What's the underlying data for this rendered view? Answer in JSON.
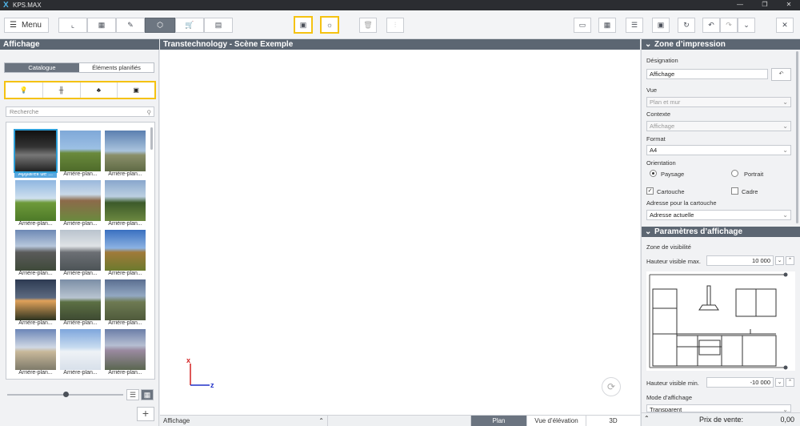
{
  "app": {
    "title": "KPS.MAX"
  },
  "toolbar": {
    "menu_label": "Menu"
  },
  "left_panel": {
    "header": "Affichage",
    "tabs": [
      "Catalogue",
      "Éléments planifiés"
    ],
    "category_icons": [
      "lightbulb-icon",
      "fence-icon",
      "tree-icon",
      "background-image-icon"
    ],
    "search_placeholder": "Recherche",
    "thumbnails": [
      {
        "caption": "Appareil de ...",
        "selected": true
      },
      {
        "caption": "Arrière-plan..."
      },
      {
        "caption": "Arrière-plan..."
      },
      {
        "caption": "Arrière-plan..."
      },
      {
        "caption": "Arrière-plan..."
      },
      {
        "caption": "Arrière-plan..."
      },
      {
        "caption": "Arrière-plan..."
      },
      {
        "caption": "Arrière-plan..."
      },
      {
        "caption": "Arrière-plan..."
      },
      {
        "caption": "Arrière-plan..."
      },
      {
        "caption": "Arrière-plan..."
      },
      {
        "caption": "Arrière-plan..."
      },
      {
        "caption": "Arrière-plan..."
      },
      {
        "caption": "Arrière-plan..."
      },
      {
        "caption": "Arrière-plan..."
      }
    ],
    "add_label": "+"
  },
  "center": {
    "header": "Transtechnology - Scène Exemple",
    "axis_x": "x",
    "axis_z": "z",
    "bottom_mode": "Affichage",
    "view_tabs": [
      "Plan",
      "Vue d’élévation",
      "3D"
    ],
    "active_view": "Plan"
  },
  "right_panel": {
    "print_zone": {
      "header": "Zone d’impression",
      "designation_label": "Désignation",
      "designation_value": "Affichage",
      "vue_label": "Vue",
      "vue_value": "Plan et mur",
      "contexte_label": "Contexte",
      "contexte_value": "Affichage",
      "format_label": "Format",
      "format_value": "A4",
      "orientation_label": "Orientation",
      "orientation_options": [
        "Paysage",
        "Portrait"
      ],
      "orientation_selected": "Paysage",
      "cartouche_label": "Cartouche",
      "cartouche_checked": true,
      "cadre_label": "Cadre",
      "cadre_checked": false,
      "address_label": "Adresse pour la cartouche",
      "address_value": "Adresse actuelle"
    },
    "display_params": {
      "header": "Paramètres d’affichage",
      "visibility_label": "Zone de visibilité",
      "max_label": "Hauteur visible max.",
      "max_value": "10 000",
      "min_label": "Hauteur visible min.",
      "min_value": "-10 000",
      "mode_label": "Mode d’affichage",
      "mode_value": "Transparent"
    },
    "price_label": "Prix de vente:",
    "price_value": "0,00"
  }
}
